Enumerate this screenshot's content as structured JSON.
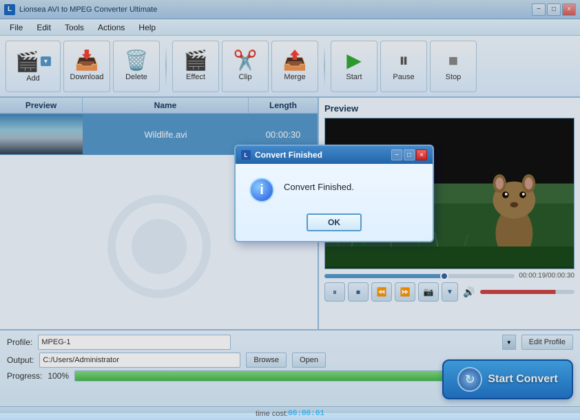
{
  "app": {
    "title": "Lionsea AVI to MPEG Converter Ultimate",
    "icon": "L"
  },
  "titlebar": {
    "minimize": "−",
    "maximize": "□",
    "close": "×"
  },
  "menu": {
    "items": [
      "File",
      "Edit",
      "Tools",
      "Actions",
      "Help"
    ]
  },
  "toolbar": {
    "add_label": "Add",
    "download_label": "Download",
    "delete_label": "Delete",
    "effect_label": "Effect",
    "clip_label": "Clip",
    "merge_label": "Merge",
    "start_label": "Start",
    "pause_label": "Pause",
    "stop_label": "Stop"
  },
  "filelist": {
    "headers": {
      "preview": "Preview",
      "name": "Name",
      "length": "Length"
    },
    "files": [
      {
        "name": "Wildlife.avi",
        "length": "00:00:30"
      }
    ]
  },
  "preview": {
    "title": "Preview",
    "time_current": "00:00:19",
    "time_total": "00:00:30",
    "time_display": "00:00:19/00:00:30",
    "progress_pct": 63
  },
  "bottom": {
    "profile_label": "Profile:",
    "profile_value": "MPEG-1",
    "edit_profile_label": "Edit Profile",
    "output_label": "Output:",
    "output_value": "C:/Users/Administrator",
    "browse_label": "Browse",
    "open_label": "Open",
    "progress_label": "Progress:",
    "progress_value": "100%",
    "progress_pct": 100,
    "start_convert_label": "Start Convert"
  },
  "statusbar": {
    "time_cost_label": "time cost: ",
    "time_cost_value": "00:00:01"
  },
  "modal": {
    "title": "Convert Finished",
    "message": "Convert Finished.",
    "ok_label": "OK"
  }
}
